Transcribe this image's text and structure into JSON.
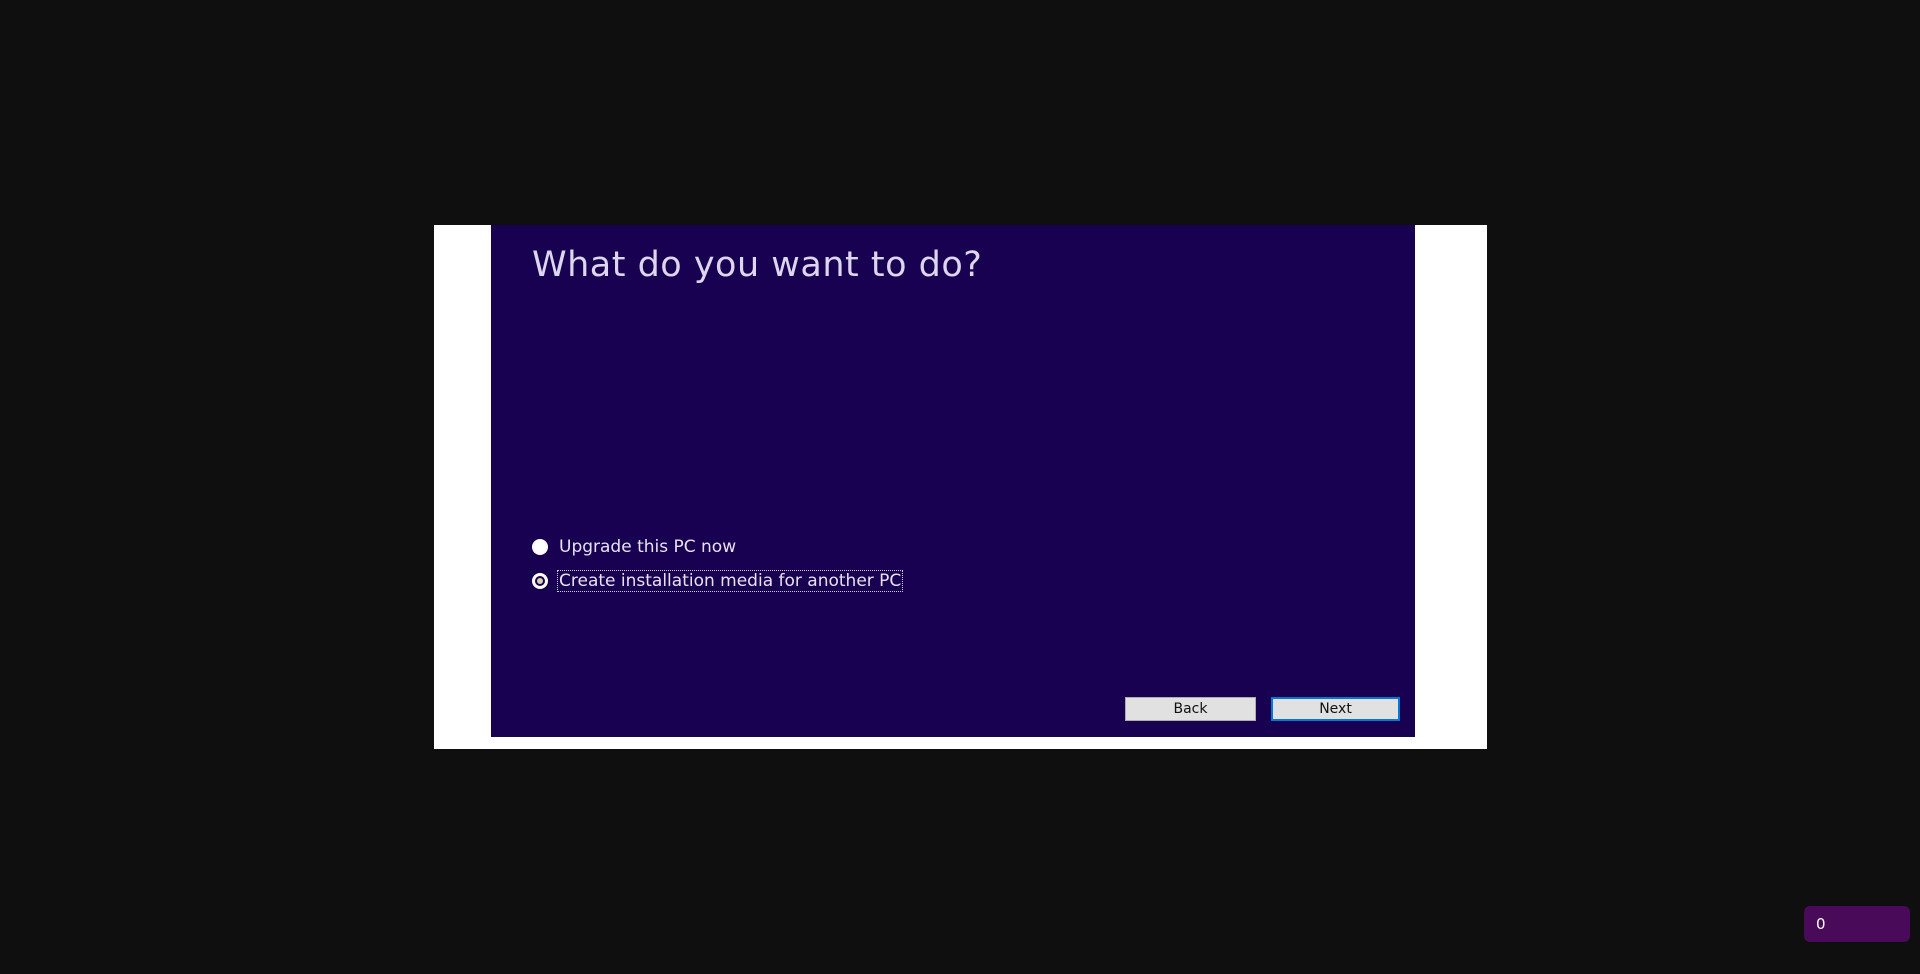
{
  "setup": {
    "title": "What do you want to do?",
    "options": [
      {
        "label": "Upgrade this PC now",
        "selected": false
      },
      {
        "label": "Create installation media for another PC",
        "selected": true
      }
    ],
    "back_label": "Back",
    "next_label": "Next"
  },
  "colors": {
    "panel_background": "#190152",
    "page_background": "#0f0f0f",
    "focus_accent": "#0078d7"
  },
  "counter": {
    "value": "0"
  }
}
